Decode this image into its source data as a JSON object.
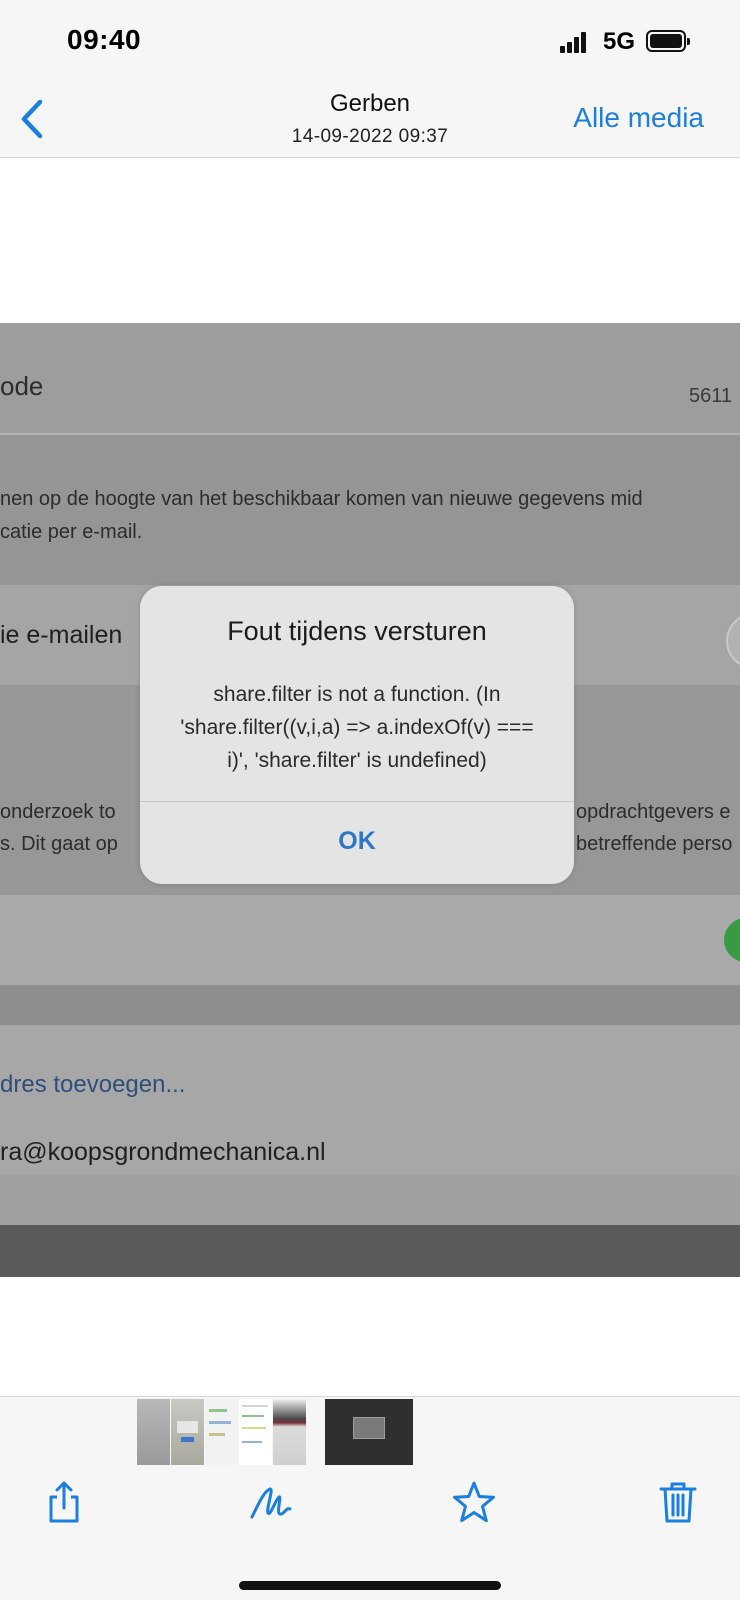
{
  "status_bar": {
    "time": "09:40",
    "network": "5G"
  },
  "nav": {
    "title": "Gerben",
    "subtitle": "14-09-2022 09:37",
    "right_label": "Alle media"
  },
  "photo": {
    "header_text": "ode",
    "header_number": "5611",
    "notify_line1": "nen op de hoogte van het beschikbaar komen van nieuwe gegevens mid",
    "notify_line2": "catie per e-mail.",
    "email_label": "ie e-mailen",
    "research_line1_left": "onderzoek to",
    "research_line1_right": "opdrachtgevers e",
    "research_line2_left": "s. Dit gaat op",
    "research_line2_right": "betreffende perso",
    "add_address": "dres toevoegen...",
    "email_address": "ra@koopsgrondmechanica.nl"
  },
  "alert": {
    "title": "Fout tijdens versturen",
    "message": "share.filter is not a function. (In 'share.filter((v,i,a) => a.indexOf(v) === i)', 'share.filter' is undefined)",
    "ok_label": "OK"
  },
  "colors": {
    "accent": "#1a7fe0",
    "alert_button": "#2c77c9"
  },
  "toolbar": {
    "icons": [
      "share-icon",
      "markup-icon",
      "favorite-icon",
      "delete-icon"
    ]
  }
}
